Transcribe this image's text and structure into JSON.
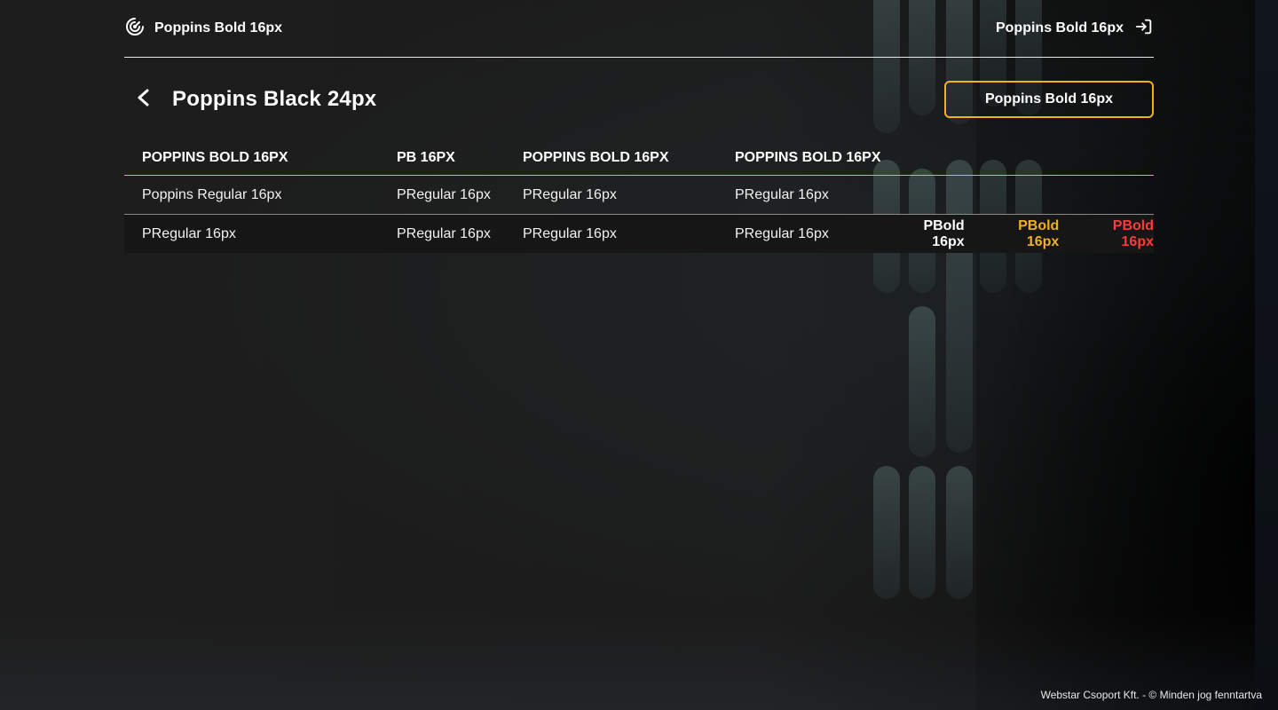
{
  "header": {
    "brand_label": "Poppins Bold 16px",
    "logout_label": "Poppins Bold 16px"
  },
  "page": {
    "title": "Poppins Black 24px",
    "action_button": "Poppins Bold 16px"
  },
  "table": {
    "columns": [
      "POPPINS BOLD 16PX",
      "PB 16PX",
      "POPPINS BOLD 16PX",
      "POPPINS BOLD 16PX"
    ],
    "rows": [
      {
        "cells": [
          "Poppins Regular 16px",
          "PRegular 16px",
          "PRegular 16px",
          "PRegular 16px"
        ]
      },
      {
        "cells": [
          "PRegular 16px",
          "PRegular 16px",
          "PRegular 16px",
          "PRegular 16px"
        ],
        "actions": [
          {
            "label": "PBold 16px",
            "color": "#ffffff"
          },
          {
            "label": "PBold 16px",
            "color": "#f0b21b"
          },
          {
            "label": "PBold 16px",
            "color": "#ff3b3b"
          }
        ]
      }
    ]
  },
  "footer": {
    "text": "Webstar Csoport Kft. - © Minden jog fenntartva"
  },
  "colors": {
    "accent": "#f0b21b",
    "danger": "#ff3b3b",
    "background": "#1c1c1c"
  }
}
